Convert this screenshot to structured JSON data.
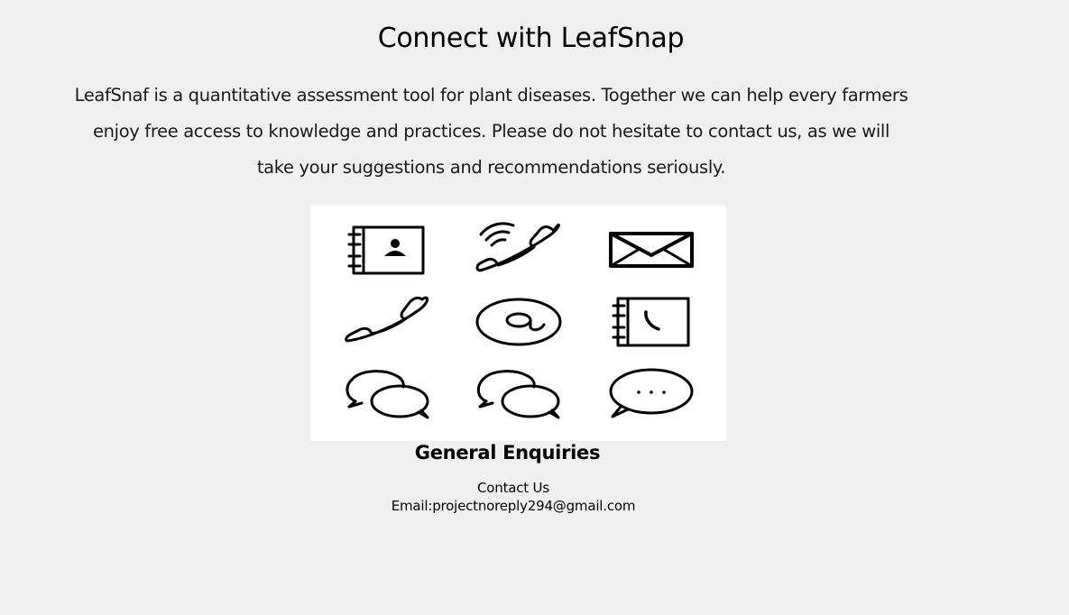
{
  "page": {
    "title": "Connect with LeafSnap",
    "intro": "LeafSnaf is a quantitative assessment tool for plant diseases. Together we can help every farmers enjoy free access to knowledge and practices. Please do not hesitate to contact us, as we will take your suggestions and recommendations seriously."
  },
  "icon_grid": {
    "background": "#ffffff",
    "icons": [
      "address-book-icon",
      "ringing-phone-icon",
      "envelope-icon",
      "phone-handset-icon",
      "at-sign-icon",
      "phone-book-icon",
      "chat-bubbles-icon",
      "chat-bubbles-icon",
      "speech-bubble-ellipsis-icon"
    ]
  },
  "enquiries": {
    "heading": "General Enquiries",
    "contact_label": "Contact Us",
    "email": "Email:projectnoreply294@gmail.com"
  },
  "colors": {
    "page_background": "#f0f0f0",
    "text": "#000000"
  }
}
